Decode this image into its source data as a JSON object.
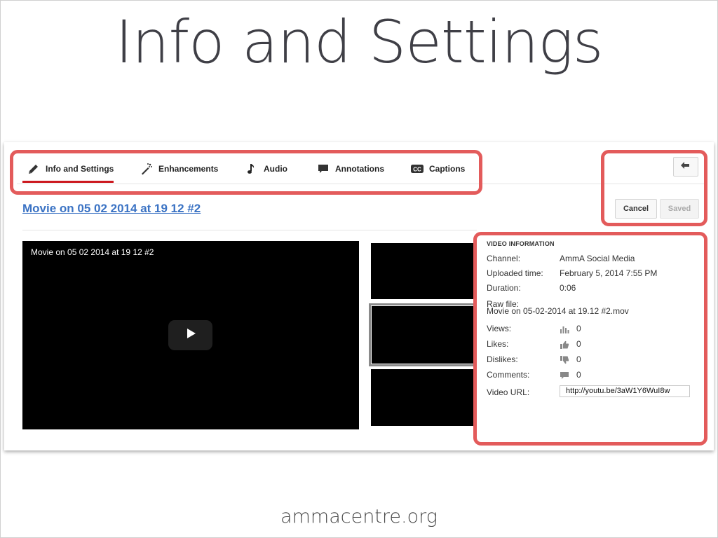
{
  "slide": {
    "title": "Info and Settings",
    "footer": "ammacentre.org"
  },
  "tabs": [
    {
      "label": "Info and Settings",
      "icon": "pencil-icon",
      "active": true
    },
    {
      "label": "Enhancements",
      "icon": "magic-wand-icon"
    },
    {
      "label": "Audio",
      "icon": "music-note-icon"
    },
    {
      "label": "Annotations",
      "icon": "speech-bubble-icon"
    },
    {
      "label": "Captions",
      "icon": "cc-icon"
    }
  ],
  "header": {
    "back_icon": "back-arrow-icon",
    "video_title": "Movie on 05 02 2014 at 19 12 #2",
    "cancel_label": "Cancel",
    "saved_label": "Saved"
  },
  "player": {
    "overlay_title": "Movie on 05 02 2014 at 19 12 #2",
    "play_icon": "play-icon"
  },
  "video_info": {
    "heading": "VIDEO INFORMATION",
    "channel_label": "Channel:",
    "channel_value": "AmmA Social Media",
    "uploaded_label": "Uploaded time:",
    "uploaded_value": "February 5, 2014 7:55 PM",
    "duration_label": "Duration:",
    "duration_value": "0:06",
    "raw_file_label": "Raw file:",
    "raw_file_value": "Movie on 05-02-2014 at 19.12 #2.mov",
    "views_label": "Views:",
    "views_value": "0",
    "likes_label": "Likes:",
    "likes_value": "0",
    "dislikes_label": "Dislikes:",
    "dislikes_value": "0",
    "comments_label": "Comments:",
    "comments_value": "0",
    "url_label": "Video URL:",
    "url_value": "http://youtu.be/3aW1Y6WuI8w"
  },
  "colors": {
    "accent_red": "#cc181e",
    "annotation_red": "#e35b5b",
    "link_blue": "#3b73c4"
  }
}
